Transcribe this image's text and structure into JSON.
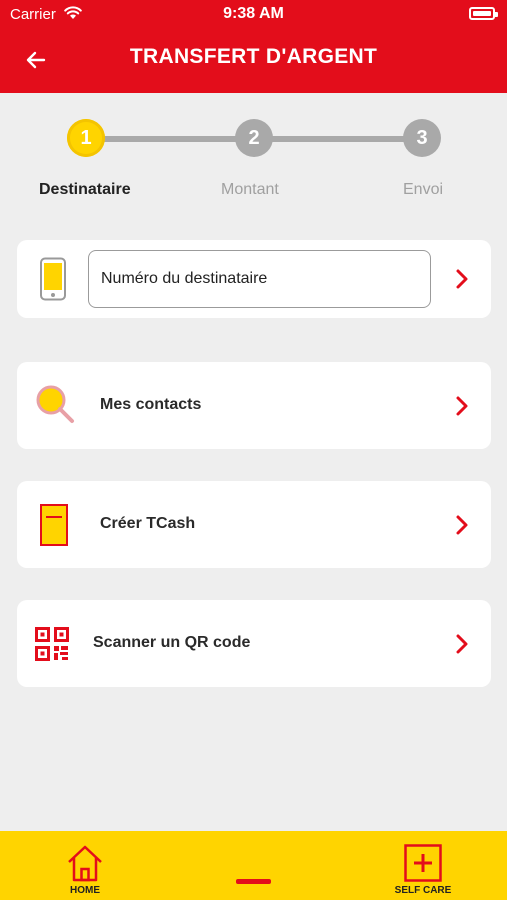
{
  "status_bar": {
    "carrier": "Carrier",
    "time": "9:38 AM"
  },
  "header": {
    "title": "TRANSFERT D'ARGENT"
  },
  "stepper": {
    "steps": [
      {
        "number": "1",
        "label": "Destinataire",
        "active": true
      },
      {
        "number": "2",
        "label": "Montant",
        "active": false
      },
      {
        "number": "3",
        "label": "Envoi",
        "active": false
      }
    ]
  },
  "recipient": {
    "placeholder": "Numéro du destinataire",
    "value": ""
  },
  "options": [
    {
      "label": "Mes contacts",
      "icon": "magnifier-icon"
    },
    {
      "label": "Créer TCash",
      "icon": "tcash-card-icon"
    },
    {
      "label": "Scanner un QR code",
      "icon": "qr-code-icon"
    }
  ],
  "bottom_nav": {
    "home_label": "HOME",
    "selfcare_label": "SELF CARE"
  },
  "colors": {
    "brand_red": "#e30d1b",
    "brand_yellow": "#ffd400",
    "inactive_grey": "#a9a9a9"
  }
}
